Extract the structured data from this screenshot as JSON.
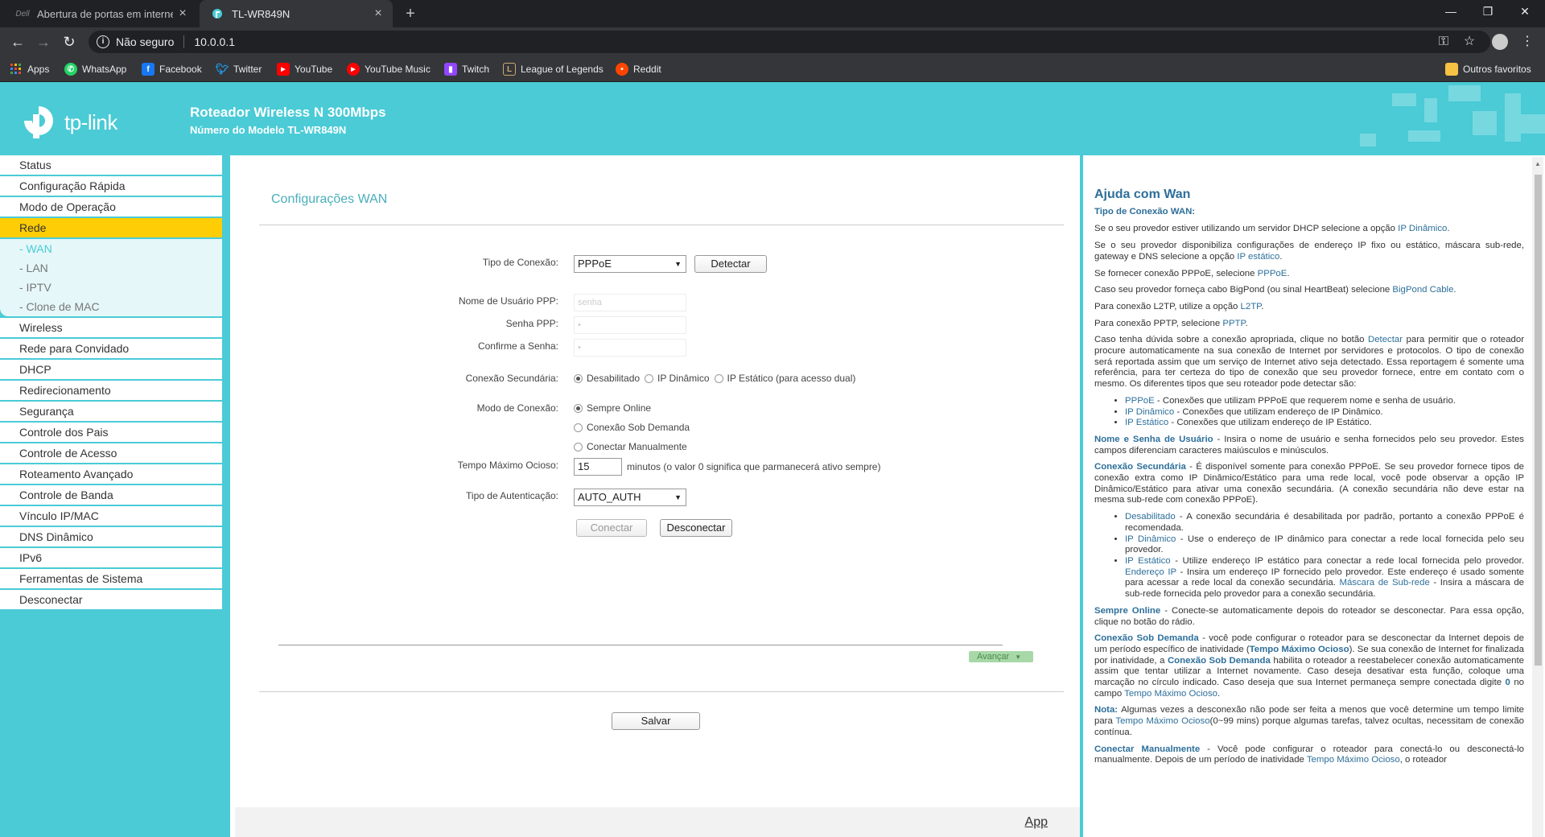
{
  "browser": {
    "tabs": [
      {
        "title": "Abertura de portas em internet c",
        "active": false
      },
      {
        "title": "TL-WR849N",
        "active": true
      }
    ],
    "address": {
      "security": "Não seguro",
      "url": "10.0.0.1"
    },
    "bookmarks": [
      {
        "label": "Apps",
        "icon": "apps-grid-icon",
        "color": "#ea4335"
      },
      {
        "label": "WhatsApp",
        "icon": "whatsapp-icon",
        "color": "#25d366"
      },
      {
        "label": "Facebook",
        "icon": "facebook-icon",
        "color": "#1877f2"
      },
      {
        "label": "Twitter",
        "icon": "twitter-icon",
        "color": "#1da1f2"
      },
      {
        "label": "YouTube",
        "icon": "youtube-icon",
        "color": "#ff0000"
      },
      {
        "label": "YouTube Music",
        "icon": "youtube-music-icon",
        "color": "#ff0000"
      },
      {
        "label": "Twitch",
        "icon": "twitch-icon",
        "color": "#9146ff"
      },
      {
        "label": "League of Legends",
        "icon": "league-icon",
        "color": "#c8aa6e"
      },
      {
        "label": "Reddit",
        "icon": "reddit-icon",
        "color": "#ff4500"
      }
    ],
    "other_bookmarks": "Outros favoritos"
  },
  "router": {
    "logo_text": "tp-link",
    "title": "Roteador Wireless N 300Mbps",
    "model": "Número do Modelo TL-WR849N",
    "accent": "#4acbd6",
    "active_color": "#ffcd05"
  },
  "menu": {
    "top": [
      "Status",
      "Configuração Rápida",
      "Modo de Operação"
    ],
    "active": "Rede",
    "submenu": [
      "- WAN",
      "- LAN",
      "- IPTV",
      "- Clone de MAC"
    ],
    "bottom": [
      "Wireless",
      "Rede para Convidado",
      "DHCP",
      "Redirecionamento",
      "Segurança",
      "Controle dos Pais",
      "Controle de Acesso",
      "Roteamento Avançado",
      "Controle de Banda",
      "Vínculo IP/MAC",
      "DNS Dinâmico",
      "IPv6",
      "Ferramentas de Sistema",
      "Desconectar"
    ]
  },
  "wan": {
    "title": "Configurações WAN",
    "conn_type_label": "Tipo de Conexão:",
    "conn_type_value": "PPPoE",
    "detect_btn": "Detectar",
    "ppp_user_label": "Nome de Usuário PPP:",
    "ppp_user_value": "senha",
    "ppp_pass_label": "Senha PPP:",
    "ppp_pass_value": "•",
    "confirm_label": "Confirme a Senha:",
    "confirm_value": "•",
    "secondary_label": "Conexão Secundária:",
    "secondary_options": [
      "Desabilitado",
      "IP Dinâmico",
      "IP Estático (para acesso dual)"
    ],
    "mode_label": "Modo de Conexão:",
    "mode_options": [
      "Sempre Online",
      "Conexão Sob Demanda",
      "Conectar Manualmente"
    ],
    "idle_label": "Tempo Máximo Ocioso:",
    "idle_value": "15",
    "idle_hint": "minutos (o valor 0 significa que parmanecerá ativo sempre)",
    "auth_label": "Tipo de Autenticação:",
    "auth_value": "AUTO_AUTH",
    "connect_btn": "Conectar",
    "disconnect_btn": "Desconectar",
    "advance_btn": "Avançar",
    "save_btn": "Salvar",
    "app_link": "App"
  },
  "help": {
    "title": "Ajuda com Wan",
    "subtitle": "Tipo de Conexão WAN:"
  }
}
